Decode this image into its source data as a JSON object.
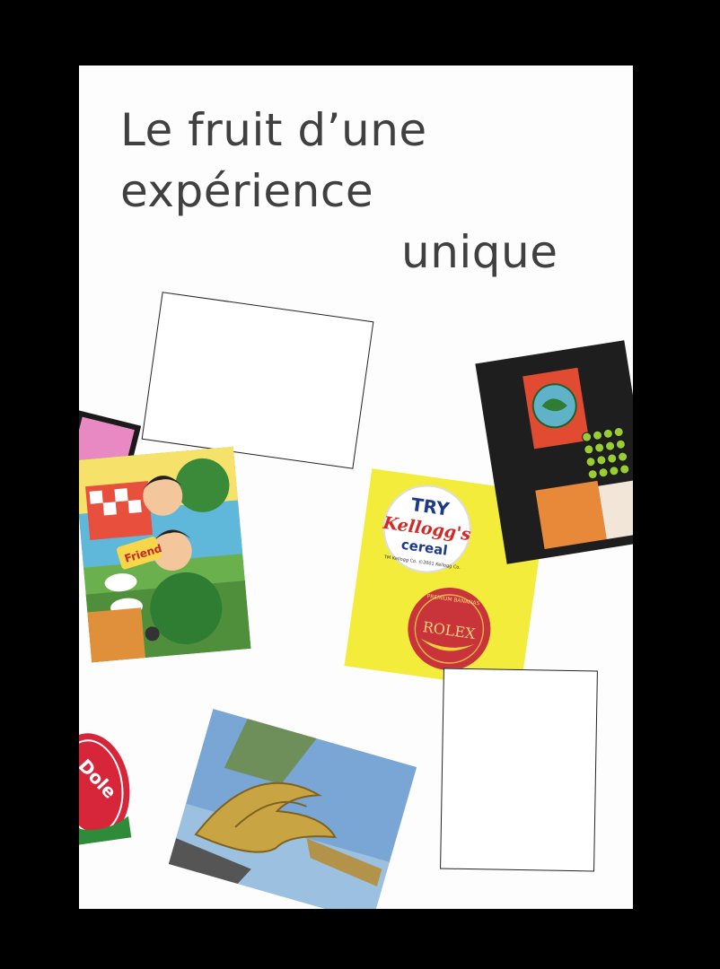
{
  "poster": {
    "title_lines": [
      "Le fruit d’une",
      "expérience",
      "unique"
    ]
  },
  "stickers": {
    "kelloggs": {
      "line1": "TRY",
      "line2": "Kellogg's",
      "line3": "cereal",
      "small_print": "TM Kellogg Co. ©2001 Kellogg Co."
    },
    "rolex": {
      "brand": "ROLEX",
      "ring_text": "PREMIUM BANANAS"
    },
    "dole": {
      "brand": "Dole"
    },
    "big_boy": {
      "sign_text": "Friend"
    }
  },
  "colors": {
    "background": "#000000",
    "paper": "#fdfdfd",
    "title_text": "#404040",
    "kelloggs_yellow": "#f3ec3a",
    "kelloggs_red": "#d42a26",
    "rolex_red": "#c8343a",
    "dole_red": "#d7263a",
    "dark_card": "#1e1e1e"
  }
}
